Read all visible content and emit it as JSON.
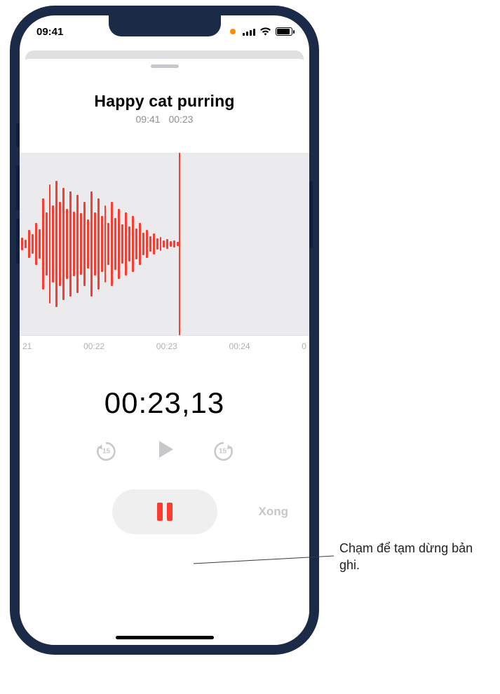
{
  "status": {
    "time": "09:41"
  },
  "recording": {
    "title": "Happy cat purring",
    "clock": "09:41",
    "duration": "00:23"
  },
  "ticks": {
    "t0": "21",
    "t1": "00:22",
    "t2": "00:23",
    "t3": "00:24",
    "t4": "0"
  },
  "timer": "00:23,13",
  "transport": {
    "back_amount": "15",
    "forward_amount": "15"
  },
  "buttons": {
    "done": "Xong"
  },
  "callout": {
    "text": "Chạm để tạm dừng bản ghi."
  }
}
